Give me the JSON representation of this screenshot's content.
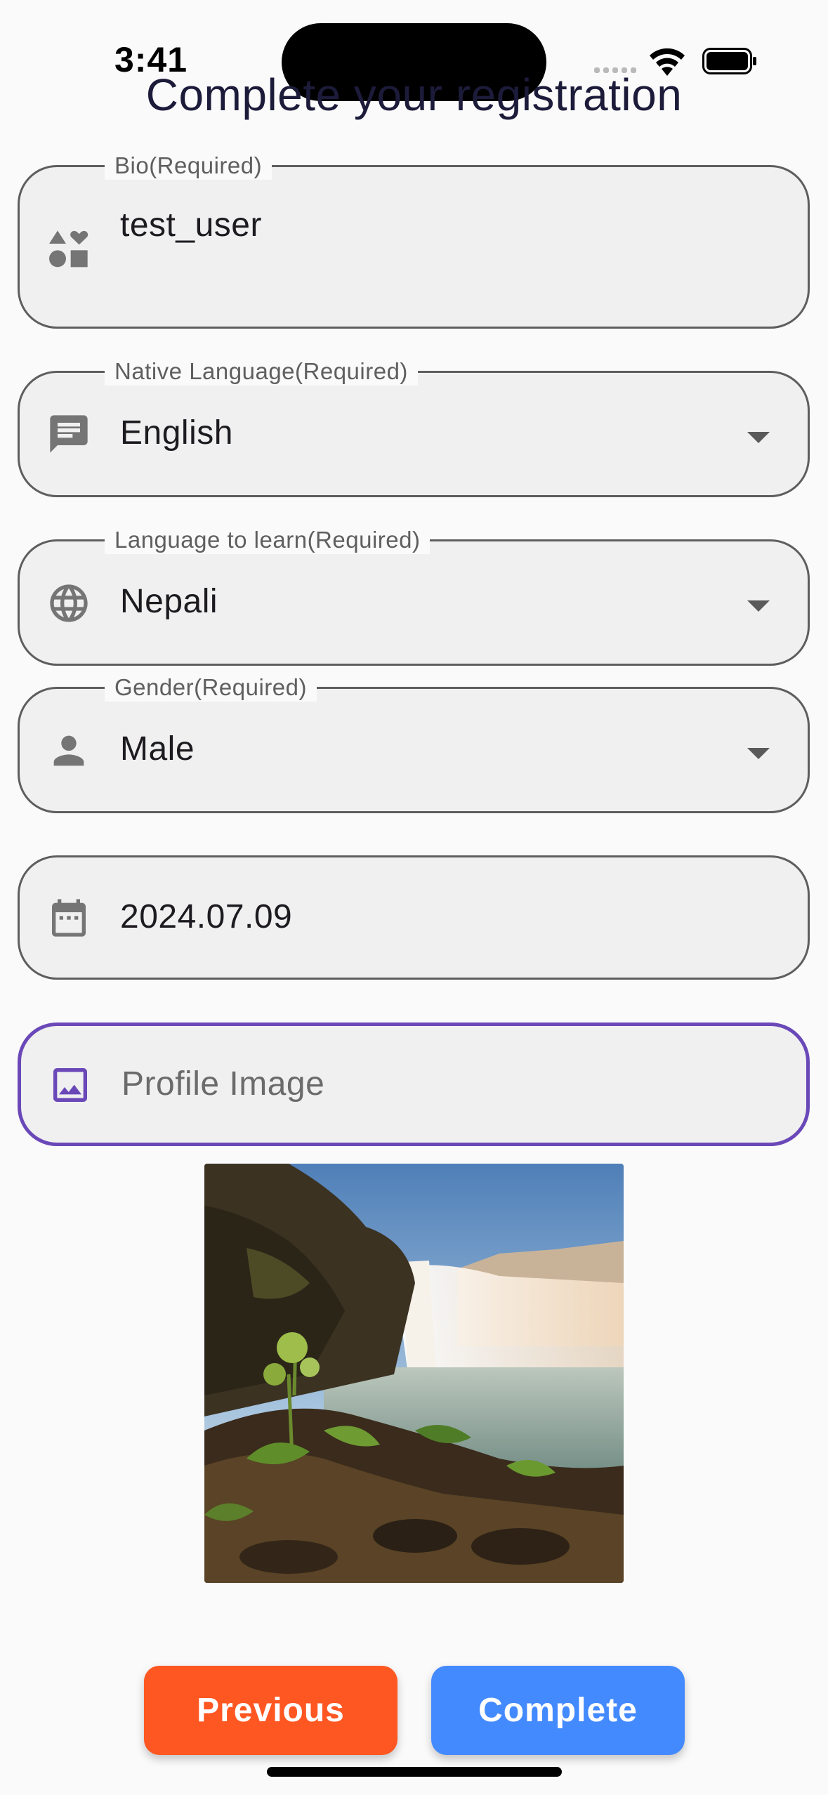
{
  "status_bar": {
    "time": "3:41"
  },
  "page": {
    "title": "Complete your registration"
  },
  "form": {
    "bio": {
      "label": "Bio(Required)",
      "value": "test_user",
      "icon": "category-icon"
    },
    "native_language": {
      "label": "Native Language(Required)",
      "value": "English",
      "icon": "message-icon"
    },
    "language_to_learn": {
      "label": "Language to learn(Required)",
      "value": "Nepali",
      "icon": "globe-icon"
    },
    "gender": {
      "label": "Gender(Required)",
      "value": "Male",
      "icon": "person-icon"
    },
    "birthdate": {
      "value": "2024.07.09",
      "icon": "calendar-icon"
    },
    "profile_image": {
      "placeholder": "Profile Image",
      "icon": "image-icon"
    }
  },
  "buttons": {
    "previous_label": "Previous",
    "complete_label": "Complete"
  },
  "colors": {
    "accent_focus": "#6a48b8",
    "previous": "#ff5722",
    "complete": "#448aff"
  }
}
